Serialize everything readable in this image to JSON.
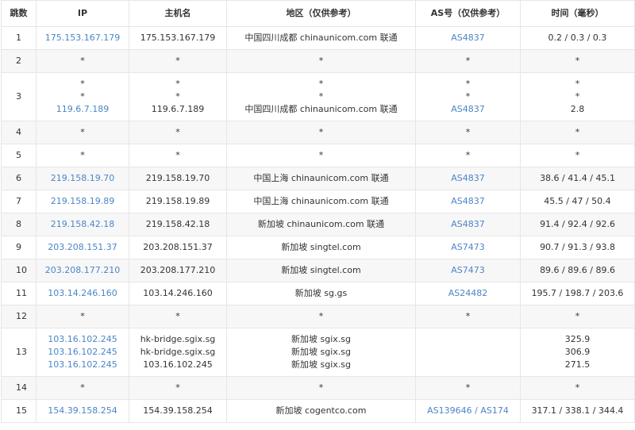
{
  "headers": {
    "hop": "跳数",
    "ip": "IP",
    "host": "主机名",
    "region": "地区（仅供参考）",
    "as": "AS号（仅供参考）",
    "time": "时间（毫秒）"
  },
  "rows": [
    {
      "hop": "1",
      "ip": [
        "175.153.167.179"
      ],
      "host": [
        "175.153.167.179"
      ],
      "region": [
        "中国四川成都 chinaunicom.com 联通"
      ],
      "as": [
        "AS4837"
      ],
      "time": [
        "0.2 / 0.3 / 0.3"
      ],
      "ip_link": true,
      "as_link": true
    },
    {
      "hop": "2",
      "ip": [
        "*"
      ],
      "host": [
        "*"
      ],
      "region": [
        "*"
      ],
      "as": [
        "*"
      ],
      "time": [
        "*"
      ],
      "ip_link": false,
      "as_link": false
    },
    {
      "hop": "3",
      "ip": [
        "*",
        "*",
        "119.6.7.189"
      ],
      "host": [
        "*",
        "*",
        "119.6.7.189"
      ],
      "region": [
        "*",
        "*",
        "中国四川成都 chinaunicom.com 联通"
      ],
      "as": [
        "*",
        "*",
        "AS4837"
      ],
      "time": [
        "*",
        "*",
        "2.8"
      ],
      "ip_link": true,
      "as_link": true
    },
    {
      "hop": "4",
      "ip": [
        "*"
      ],
      "host": [
        "*"
      ],
      "region": [
        "*"
      ],
      "as": [
        "*"
      ],
      "time": [
        "*"
      ],
      "ip_link": false,
      "as_link": false
    },
    {
      "hop": "5",
      "ip": [
        "*"
      ],
      "host": [
        "*"
      ],
      "region": [
        "*"
      ],
      "as": [
        "*"
      ],
      "time": [
        "*"
      ],
      "ip_link": false,
      "as_link": false
    },
    {
      "hop": "6",
      "ip": [
        "219.158.19.70"
      ],
      "host": [
        "219.158.19.70"
      ],
      "region": [
        "中国上海 chinaunicom.com 联通"
      ],
      "as": [
        "AS4837"
      ],
      "time": [
        "38.6 / 41.4 / 45.1"
      ],
      "ip_link": true,
      "as_link": true
    },
    {
      "hop": "7",
      "ip": [
        "219.158.19.89"
      ],
      "host": [
        "219.158.19.89"
      ],
      "region": [
        "中国上海 chinaunicom.com 联通"
      ],
      "as": [
        "AS4837"
      ],
      "time": [
        "45.5 / 47 / 50.4"
      ],
      "ip_link": true,
      "as_link": true
    },
    {
      "hop": "8",
      "ip": [
        "219.158.42.18"
      ],
      "host": [
        "219.158.42.18"
      ],
      "region": [
        "新加坡 chinaunicom.com 联通"
      ],
      "as": [
        "AS4837"
      ],
      "time": [
        "91.4 / 92.4 / 92.6"
      ],
      "ip_link": true,
      "as_link": true
    },
    {
      "hop": "9",
      "ip": [
        "203.208.151.37"
      ],
      "host": [
        "203.208.151.37"
      ],
      "region": [
        "新加坡 singtel.com"
      ],
      "as": [
        "AS7473"
      ],
      "time": [
        "90.7 / 91.3 / 93.8"
      ],
      "ip_link": true,
      "as_link": true
    },
    {
      "hop": "10",
      "ip": [
        "203.208.177.210"
      ],
      "host": [
        "203.208.177.210"
      ],
      "region": [
        "新加坡 singtel.com"
      ],
      "as": [
        "AS7473"
      ],
      "time": [
        "89.6 / 89.6 / 89.6"
      ],
      "ip_link": true,
      "as_link": true
    },
    {
      "hop": "11",
      "ip": [
        "103.14.246.160"
      ],
      "host": [
        "103.14.246.160"
      ],
      "region": [
        "新加坡 sg.gs"
      ],
      "as": [
        "AS24482"
      ],
      "time": [
        "195.7 / 198.7 / 203.6"
      ],
      "ip_link": true,
      "as_link": true
    },
    {
      "hop": "12",
      "ip": [
        "*"
      ],
      "host": [
        "*"
      ],
      "region": [
        "*"
      ],
      "as": [
        "*"
      ],
      "time": [
        "*"
      ],
      "ip_link": false,
      "as_link": false
    },
    {
      "hop": "13",
      "ip": [
        "103.16.102.245",
        "103.16.102.245",
        "103.16.102.245"
      ],
      "host": [
        "hk-bridge.sgix.sg",
        "hk-bridge.sgix.sg",
        "103.16.102.245"
      ],
      "region": [
        "新加坡 sgix.sg",
        "新加坡 sgix.sg",
        "新加坡 sgix.sg"
      ],
      "as": [
        ""
      ],
      "time": [
        "325.9",
        "306.9",
        "271.5"
      ],
      "ip_link": true,
      "as_link": false
    },
    {
      "hop": "14",
      "ip": [
        "*"
      ],
      "host": [
        "*"
      ],
      "region": [
        "*"
      ],
      "as": [
        "*"
      ],
      "time": [
        "*"
      ],
      "ip_link": false,
      "as_link": false
    },
    {
      "hop": "15",
      "ip": [
        "154.39.158.254"
      ],
      "host": [
        "154.39.158.254"
      ],
      "region": [
        "新加坡 cogentco.com"
      ],
      "as": [
        "AS139646 / AS174"
      ],
      "time": [
        "317.1 / 338.1 / 344.4"
      ],
      "ip_link": true,
      "as_link": true
    }
  ],
  "colors": {
    "link": "#4a86c8",
    "text": "#333333",
    "border": "#e6e6e6",
    "stripe": "#f7f7f7"
  }
}
